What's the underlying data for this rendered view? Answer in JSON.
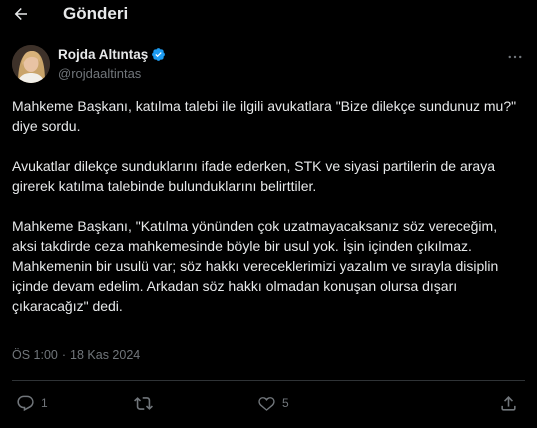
{
  "header": {
    "title": "Gönderi"
  },
  "author": {
    "display_name": "Rojda Altıntaş",
    "handle": "@rojdaaltintas",
    "verified_color": "#1d9bf0"
  },
  "tweet": {
    "paragraphs": [
      "Mahkeme Başkanı, katılma talebi ile ilgili avukatlara \"Bize dilekçe sundunuz mu?\" diye sordu.",
      "Avukatlar dilekçe sunduklarını ifade ederken, STK ve siyasi partilerin de araya girerek katılma talebinde bulunduklarını belirttiler.",
      "Mahkeme Başkanı, \"Katılma yönünden çok uzatmayacaksanız söz vereceğim, aksi takdirde ceza mahkemesinde böyle bir usul yok. İşin içinden çıkılmaz. Mahkemenin bir usulü var; söz hakkı vereceklerimizi yazalım ve sırayla disiplin içinde devam edelim. Arkadan söz hakkı olmadan konuşan olursa dışarı çıkaracağız\" dedi."
    ],
    "time": "ÖS 1:00",
    "separator": "·",
    "date": "18 Kas 2024"
  },
  "actions": {
    "reply_count": "1",
    "retweet_count": "",
    "like_count": "5"
  },
  "colors": {
    "background": "#000000",
    "text": "#e7e9ea",
    "muted": "#71767b",
    "accent": "#1d9bf0"
  },
  "icons": [
    "back-arrow-icon",
    "verified-badge-icon",
    "more-icon",
    "reply-icon",
    "retweet-icon",
    "like-icon",
    "share-icon"
  ]
}
